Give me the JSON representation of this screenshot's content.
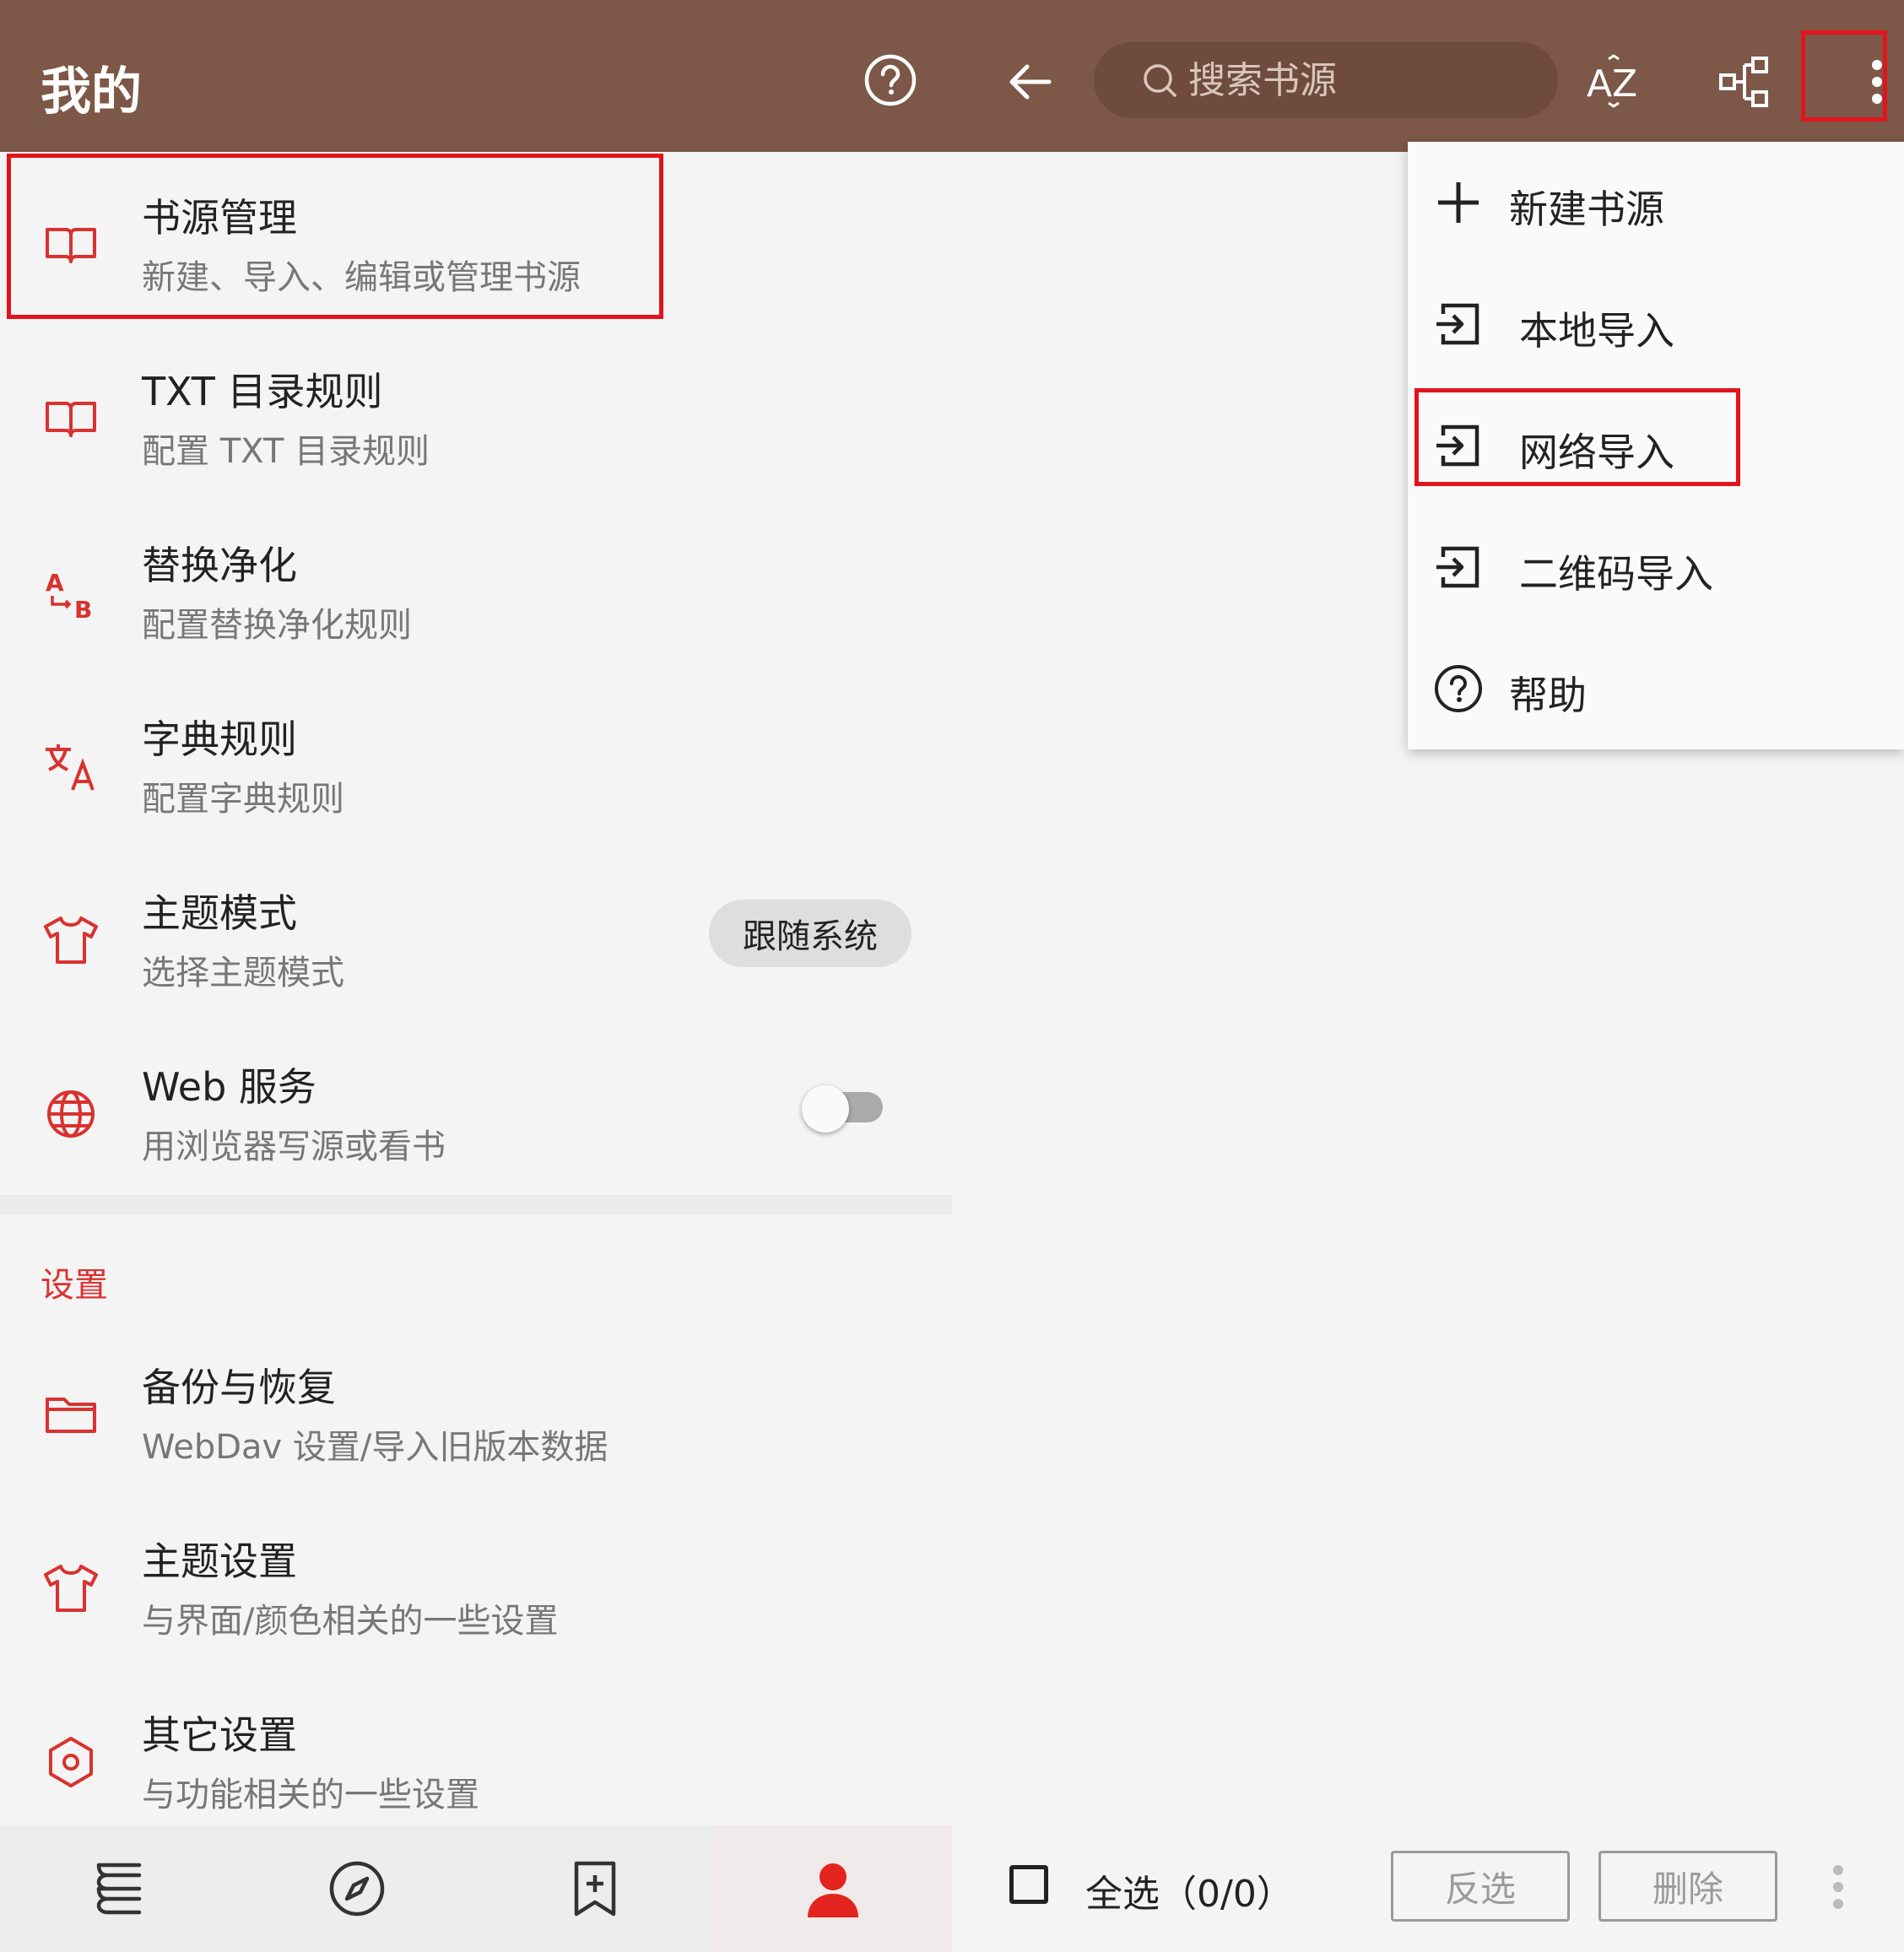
{
  "left": {
    "title": "我的",
    "items": [
      {
        "title": "书源管理",
        "subtitle": "新建、导入、编辑或管理书源"
      },
      {
        "title": "TXT 目录规则",
        "subtitle": "配置 TXT 目录规则"
      },
      {
        "title": "替换净化",
        "subtitle": "配置替换净化规则"
      },
      {
        "title": "字典规则",
        "subtitle": "配置字典规则"
      },
      {
        "title": "主题模式",
        "subtitle": "选择主题模式"
      },
      {
        "title": "Web 服务",
        "subtitle": "用浏览器写源或看书"
      }
    ],
    "theme_mode_value": "跟随系统",
    "web_service_enabled": false,
    "section_label": "设置",
    "settings": [
      {
        "title": "备份与恢复",
        "subtitle": "WebDav 设置/导入旧版本数据"
      },
      {
        "title": "主题设置",
        "subtitle": "与界面/颜色相关的一些设置"
      },
      {
        "title": "其它设置",
        "subtitle": "与功能相关的一些设置"
      }
    ]
  },
  "right": {
    "search_placeholder": "搜索书源",
    "menu": [
      "新建书源",
      "本地导入",
      "网络导入",
      "二维码导入",
      "帮助"
    ],
    "select_all": "全选（0/0）",
    "invert_label": "反选",
    "delete_label": "删除"
  },
  "colors": {
    "appbar": "#7d5747",
    "accent": "#d9322f",
    "highlight": "#e3131b"
  }
}
